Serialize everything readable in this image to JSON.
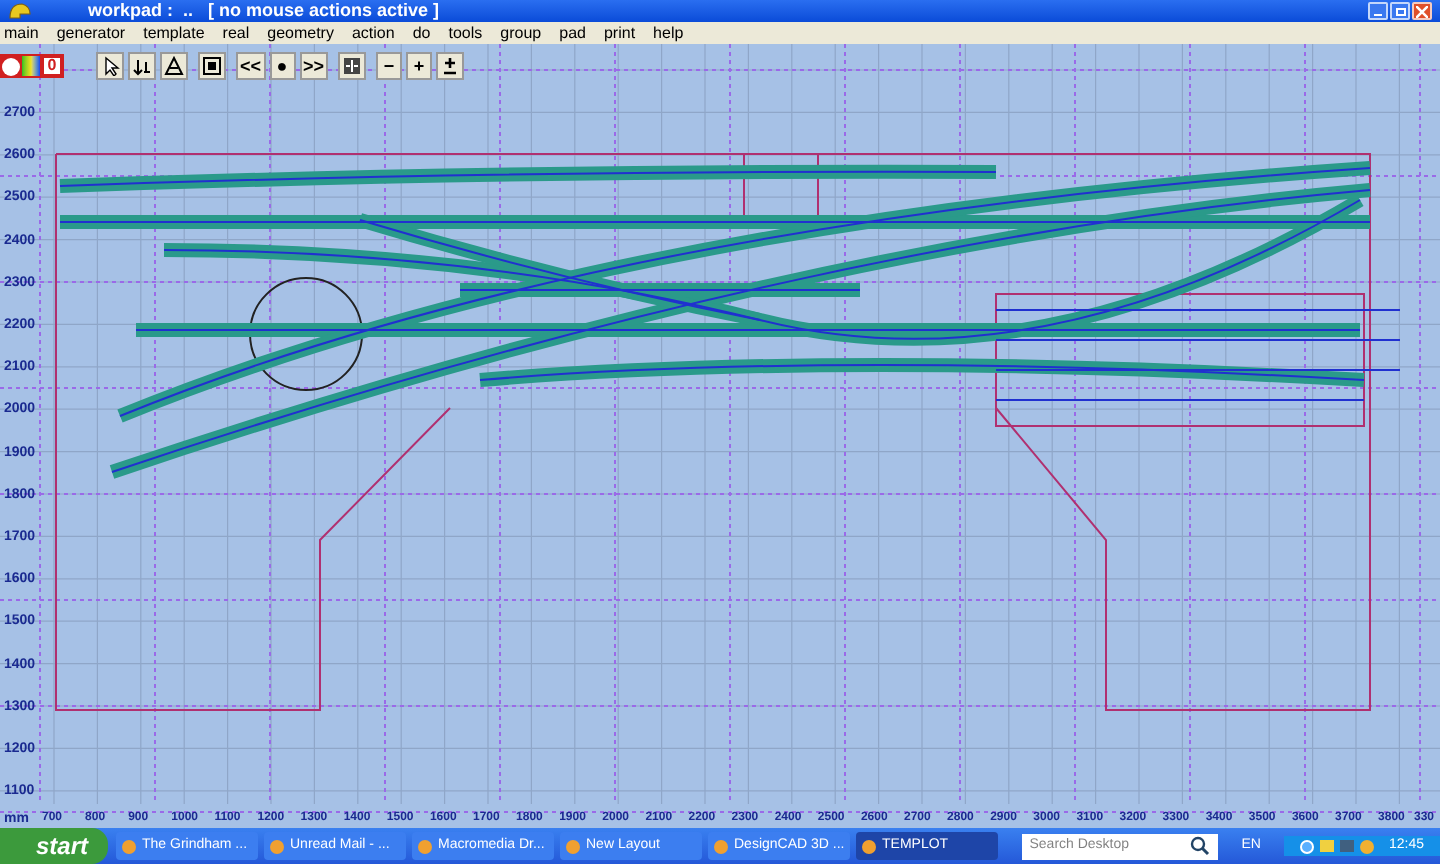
{
  "window": {
    "title": "workpad :  ..   [ no mouse actions active ]"
  },
  "menu": [
    "main",
    "generator",
    "template",
    "real",
    "geometry",
    "action",
    "do",
    "tools",
    "group",
    "pad",
    "print",
    "help"
  ],
  "toolbar": [
    {
      "kind": "icon"
    },
    {
      "kind": "icon"
    },
    {
      "kind": "icon"
    },
    {
      "kind": "icon"
    },
    {
      "kind": "text",
      "label": "<<"
    },
    {
      "kind": "text",
      "label": "●"
    },
    {
      "kind": "text",
      "label": ">>"
    },
    {
      "kind": "icon"
    },
    {
      "kind": "text",
      "label": "−"
    },
    {
      "kind": "text",
      "label": "+"
    },
    {
      "kind": "icon"
    }
  ],
  "status_buttons": [
    {
      "kind": "dot"
    },
    {
      "kind": "colors"
    },
    {
      "kind": "text",
      "label": "0"
    }
  ],
  "y_axis": [
    "2700",
    "2600",
    "2500",
    "2400",
    "2300",
    "2200",
    "2100",
    "2000",
    "1900",
    "1800",
    "1700",
    "1600",
    "1500",
    "1400",
    "1300",
    "1200",
    "1100"
  ],
  "x_axis": {
    "unit": "mm",
    "labels": [
      "700",
      "800",
      "900",
      "1000",
      "1100",
      "1200",
      "1300",
      "1400",
      "1500",
      "1600",
      "1700",
      "1800",
      "1900",
      "2000",
      "2100",
      "2200",
      "2300",
      "2400",
      "2500",
      "2600",
      "2700",
      "2800",
      "2900",
      "3000",
      "3100",
      "3200",
      "3300",
      "3400",
      "3500",
      "3600",
      "3700",
      "3800",
      "330"
    ]
  },
  "taskbar": {
    "start": "start",
    "items": [
      {
        "label": "The Grindham ...",
        "selected": false
      },
      {
        "label": "Unread Mail - ...",
        "selected": false
      },
      {
        "label": "Macromedia Dr...",
        "selected": false
      },
      {
        "label": "New Layout",
        "selected": false
      },
      {
        "label": "DesignCAD 3D ...",
        "selected": false
      },
      {
        "label": "TEMPLOT",
        "selected": true
      }
    ],
    "search_placeholder": "Search Desktop",
    "language": "EN",
    "clock": "12:45"
  }
}
